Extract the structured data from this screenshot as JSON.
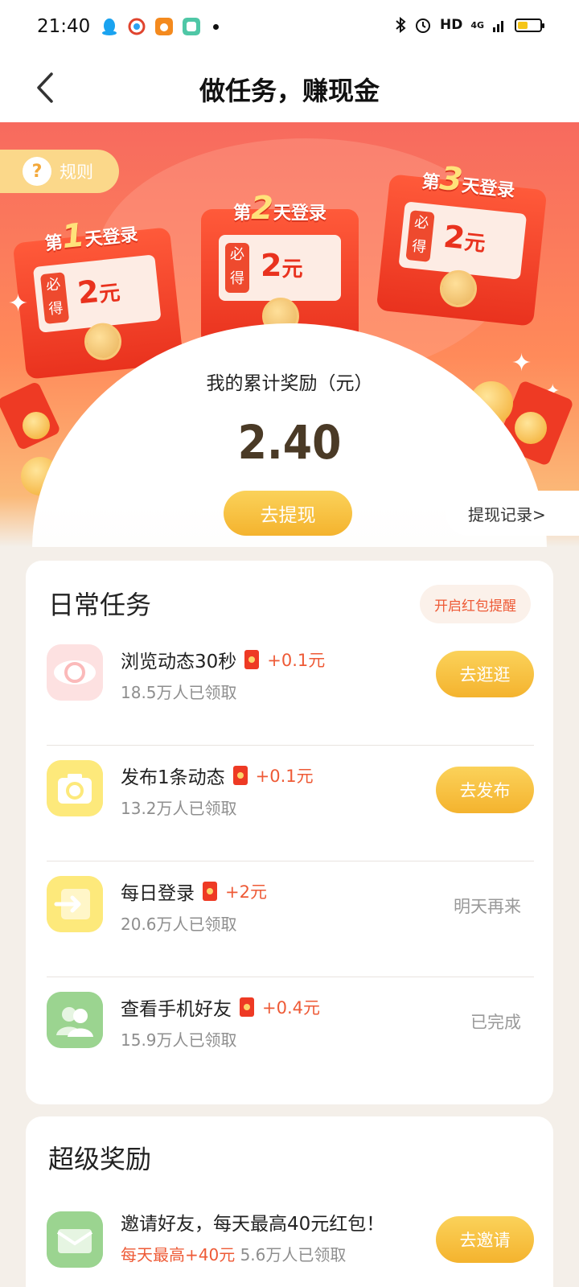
{
  "status_bar": {
    "time": "21:40",
    "network": "HD",
    "signal": "4G",
    "battery_level": 0.45,
    "app_icons": [
      "qq-icon",
      "weibo-icon",
      "uc-browser-icon",
      "app-icon"
    ]
  },
  "header": {
    "back_icon": "chevron-left-icon",
    "title": "做任务，赚现金"
  },
  "hero": {
    "rules_label": "规则",
    "rules_icon_char": "?",
    "envelopes": [
      {
        "prefix": "第",
        "day": "1",
        "suffix": "天登录",
        "tag": "必得",
        "amount": "2",
        "unit": "元"
      },
      {
        "prefix": "第",
        "day": "2",
        "suffix": "天登录",
        "tag": "必得",
        "amount": "2",
        "unit": "元"
      },
      {
        "prefix": "第",
        "day": "3",
        "suffix": "天登录",
        "tag": "必得",
        "amount": "2",
        "unit": "元"
      }
    ],
    "total_label": "我的累计奖励（元）",
    "total_value": "2.40",
    "withdraw_label": "去提现",
    "record_label": "提现记录>"
  },
  "daily": {
    "title": "日常任务",
    "remind_label": "开启红包提醒",
    "tasks": [
      {
        "name": "浏览动态30秒",
        "reward": "+0.1元",
        "count": "18.5万人已领取",
        "action": "去逛逛",
        "status": ""
      },
      {
        "name": "发布1条动态",
        "reward": "+0.1元",
        "count": "13.2万人已领取",
        "action": "去发布",
        "status": ""
      },
      {
        "name": "每日登录",
        "reward": "+2元",
        "count": "20.6万人已领取",
        "action": "",
        "status": "明天再来"
      },
      {
        "name": "查看手机好友",
        "reward": "+0.4元",
        "count": "15.9万人已领取",
        "action": "",
        "status": "已完成"
      }
    ]
  },
  "super": {
    "title": "超级奖励",
    "item": {
      "name": "邀请好友，每天最高40元红包！",
      "highlight": "每天最高+40元",
      "count": "5.6万人已领取",
      "action": "去邀请"
    }
  },
  "colors": {
    "accent": "#ee5a36",
    "button_gold": "#f4b32e",
    "hero_red": "#f76a5e"
  }
}
